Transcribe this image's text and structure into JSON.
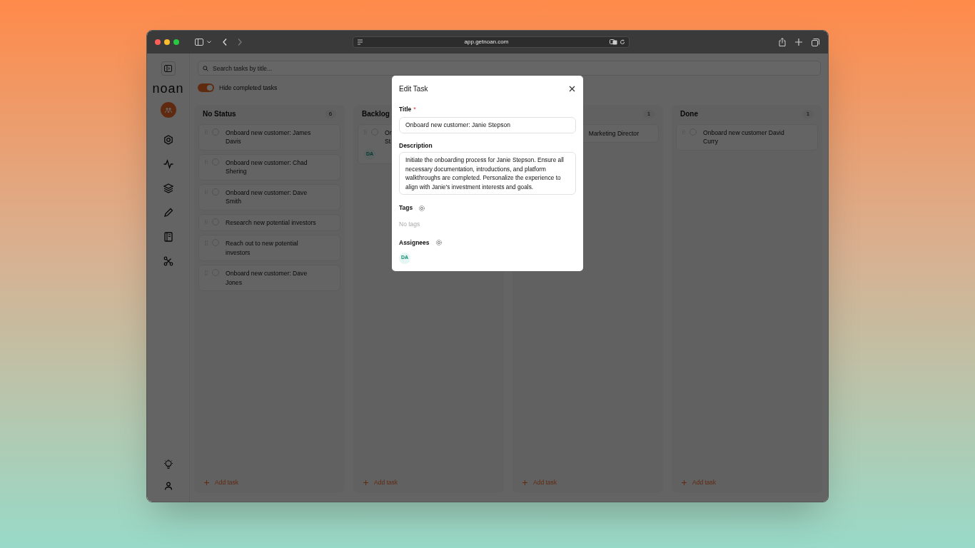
{
  "browser": {
    "url": "app.getnoan.com",
    "forward_disabled": true
  },
  "sidebar": {
    "logo": "noan"
  },
  "search": {
    "placeholder": "Search tasks by title..."
  },
  "hide_completed": {
    "label": "Hide completed tasks",
    "on": true
  },
  "columns": [
    {
      "title": "No Status",
      "count": "6",
      "cards": [
        {
          "kind": "full",
          "title_lines": [
            "Onboard new customer: James",
            "Davis"
          ],
          "checked": false
        },
        {
          "kind": "full",
          "title_lines": [
            "Onboard new customer: Chad",
            "Shering"
          ],
          "checked": false
        },
        {
          "kind": "full",
          "title_lines": [
            "Onboard new customer: Dave",
            "Smith"
          ],
          "checked": false
        },
        {
          "kind": "full",
          "title_lines": [
            "Research new potential investors"
          ],
          "checked": false
        },
        {
          "kind": "full",
          "title_lines": [
            "Reach out to new potential",
            "investors"
          ],
          "checked": false
        },
        {
          "kind": "full",
          "title_lines": [
            "Onboard new customer: Dave",
            "Jones"
          ],
          "checked": false
        }
      ],
      "add_label": "Add task"
    },
    {
      "title": "Backlog",
      "cards": [
        {
          "kind": "full",
          "title_lines": [
            "Or",
            "St"
          ],
          "checked": false,
          "assignees": [
            "DA"
          ]
        }
      ],
      "add_label": "Add task"
    },
    {
      "count": "1",
      "cards": [
        {
          "kind": "cut",
          "title_lines": [
            "Marketing Director"
          ]
        }
      ],
      "add_label": "Add task"
    },
    {
      "title": "Done",
      "count": "1",
      "cards": [
        {
          "kind": "full",
          "title_lines": [
            "Onboard new customer David",
            "Curry"
          ],
          "checked": false
        }
      ],
      "add_label": "Add task"
    }
  ],
  "modal": {
    "title": "Edit Task",
    "title_label": "Title",
    "required_marker": "*",
    "title_value": "Onboard new customer: Janie Stepson",
    "description_label": "Description",
    "description": "Initiate the onboarding process for Janie Stepson. Ensure all necessary documentation, introductions, and platform walkthroughs are completed. Personalize the experience to align with Janie's investment interests and goals.",
    "tags_label": "Tags",
    "tags_empty": "No tags",
    "assignees_label": "Assignees",
    "assignees": [
      "DA"
    ]
  }
}
